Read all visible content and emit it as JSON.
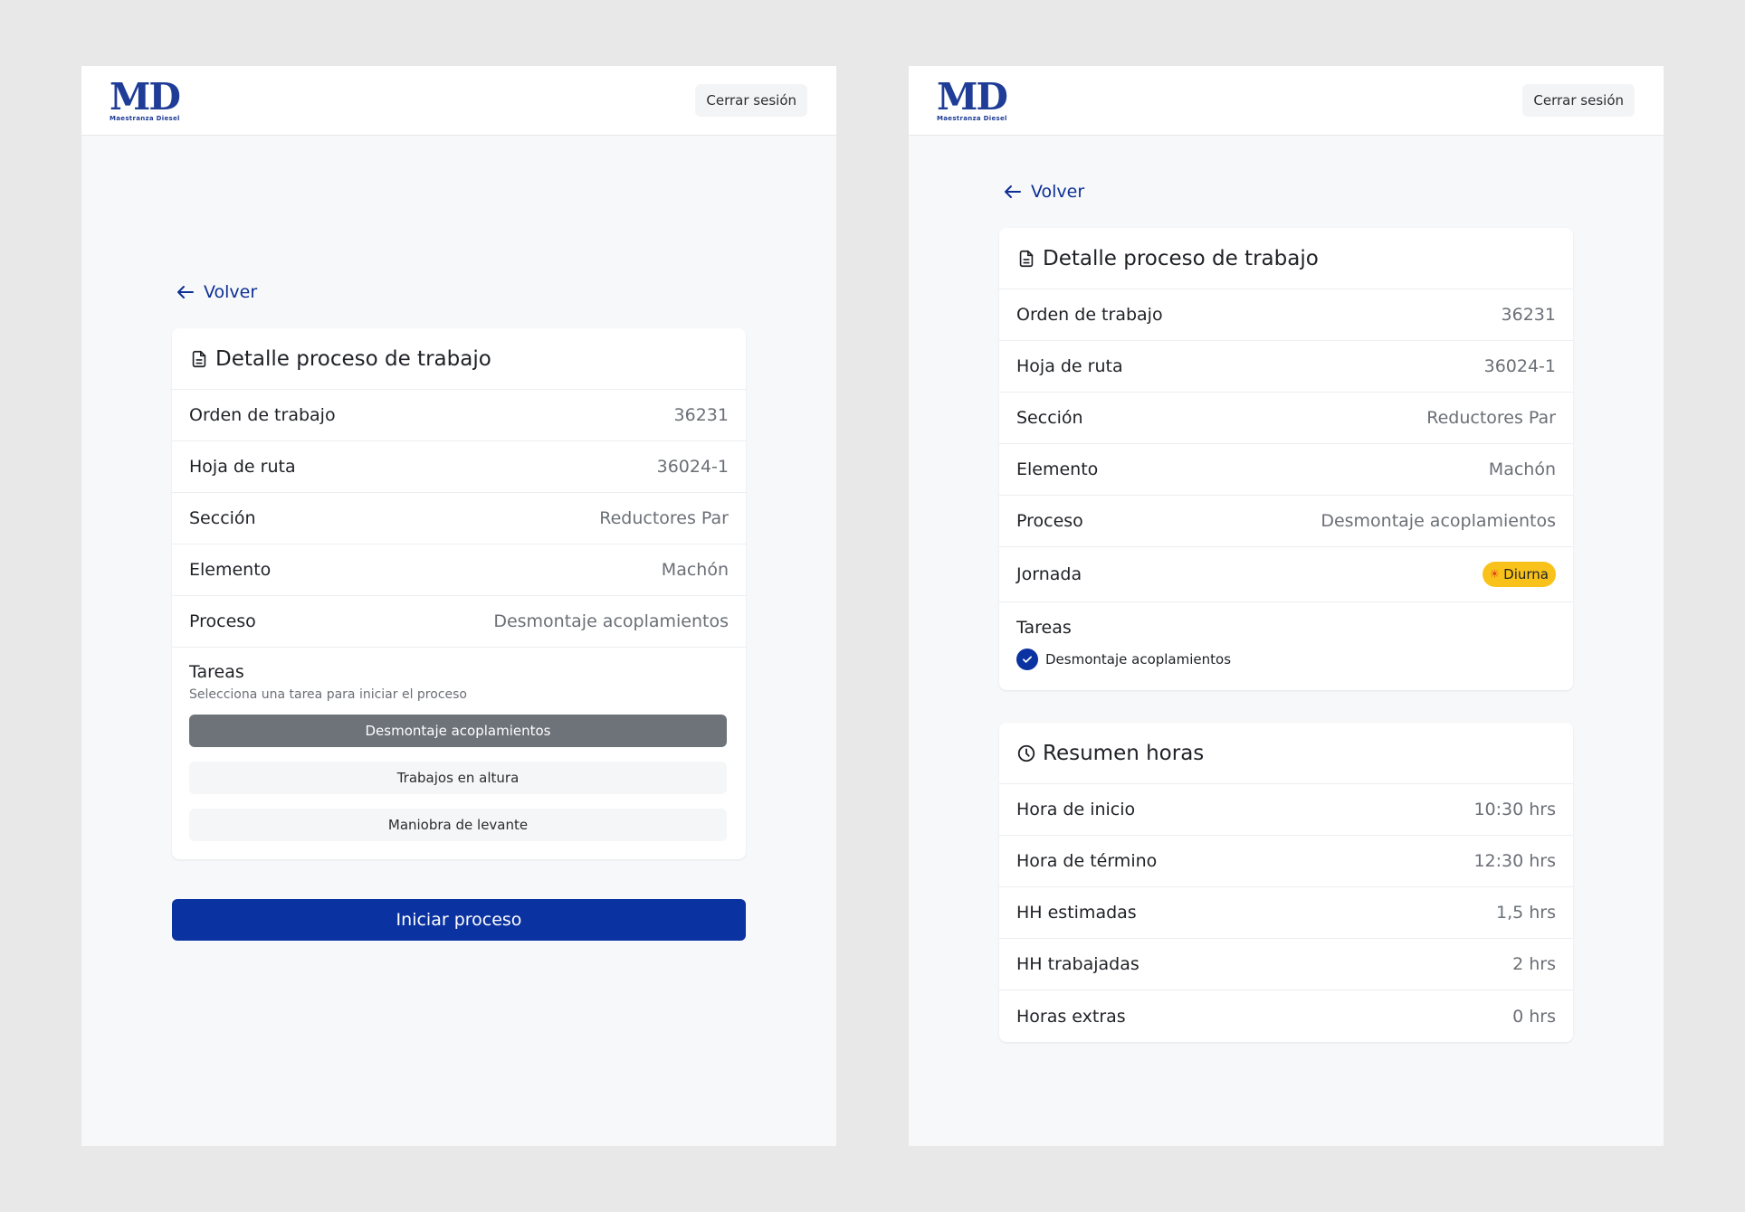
{
  "brand": {
    "logo_text": "MD",
    "logo_subtext": "Maestranza Diesel",
    "primary_color": "#0a32a0"
  },
  "header": {
    "logout_label": "Cerrar sesión"
  },
  "left": {
    "back_label": "Volver",
    "card_title": "Detalle proceso de trabajo",
    "fields": [
      {
        "label": "Orden de trabajo",
        "value": "36231"
      },
      {
        "label": "Hoja de ruta",
        "value": "36024-1"
      },
      {
        "label": "Sección",
        "value": "Reductores Par"
      },
      {
        "label": "Elemento",
        "value": "Machón"
      },
      {
        "label": "Proceso",
        "value": "Desmontaje acoplamientos"
      }
    ],
    "tasks_title": "Tareas",
    "tasks_hint": "Selecciona una tarea para iniciar el proceso",
    "tasks": [
      {
        "label": "Desmontaje acoplamientos",
        "selected": true
      },
      {
        "label": "Trabajos en altura",
        "selected": false
      },
      {
        "label": "Maniobra de levante",
        "selected": false
      }
    ],
    "start_label": "Iniciar proceso"
  },
  "right": {
    "back_label": "Volver",
    "card_title": "Detalle proceso de trabajo",
    "fields": [
      {
        "label": "Orden de trabajo",
        "value": "36231"
      },
      {
        "label": "Hoja de ruta",
        "value": "36024-1"
      },
      {
        "label": "Sección",
        "value": "Reductores Par"
      },
      {
        "label": "Elemento",
        "value": "Machón"
      },
      {
        "label": "Proceso",
        "value": "Desmontaje acoplamientos"
      }
    ],
    "shift_label": "Jornada",
    "shift_value": "Diurna",
    "shift_icon": "sun-icon",
    "shift_color": "#f9c21a",
    "tasks_title": "Tareas",
    "completed_task": "Desmontaje acoplamientos",
    "summary_title": "Resumen horas",
    "summary": [
      {
        "label": "Hora de inicio",
        "value": "10:30 hrs"
      },
      {
        "label": "Hora de término",
        "value": "12:30 hrs"
      },
      {
        "label": "HH estimadas",
        "value": "1,5 hrs"
      },
      {
        "label": "HH trabajadas",
        "value": "2 hrs"
      },
      {
        "label": "Horas extras",
        "value": "0 hrs"
      }
    ]
  }
}
